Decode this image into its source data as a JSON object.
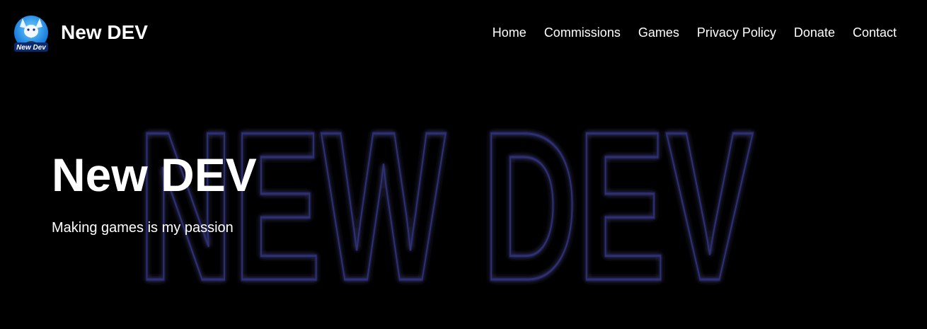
{
  "header": {
    "brand": "New DEV",
    "logo_text": "New Dev",
    "nav": [
      {
        "label": "Home"
      },
      {
        "label": "Commissions"
      },
      {
        "label": "Games"
      },
      {
        "label": "Privacy Policy"
      },
      {
        "label": "Donate"
      },
      {
        "label": "Contact"
      }
    ]
  },
  "hero": {
    "background_text": "NEW DEV",
    "title": "New DEV",
    "subtitle": "Making games is my passion"
  },
  "colors": {
    "background": "#000000",
    "text": "#ffffff",
    "neon_glow": "#1c1c9c",
    "neon_stroke": "#3a3a4a",
    "logo_accent": "#1e90ff"
  }
}
